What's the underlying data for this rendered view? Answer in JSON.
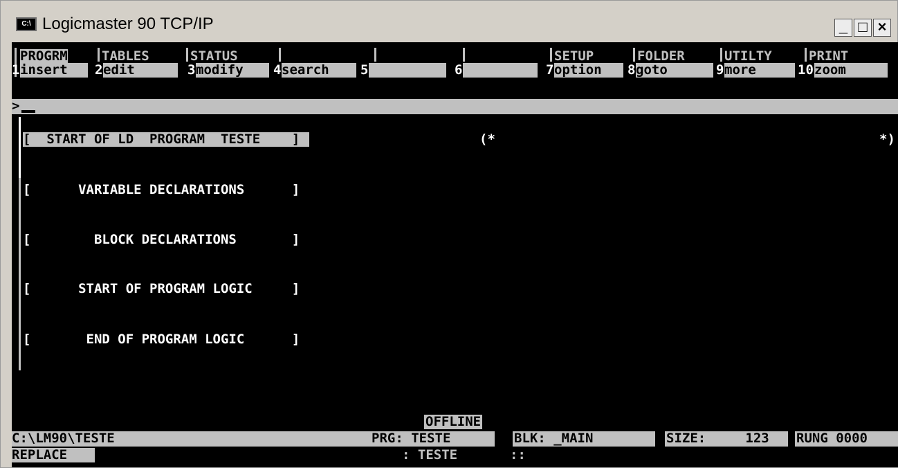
{
  "window": {
    "title": "Logicmaster 90 TCP/IP",
    "icon_label": "C:\\",
    "minimize": "_",
    "maximize": "□",
    "close": "×"
  },
  "menu": {
    "groups": [
      "PROGRM",
      "TABLES",
      "STATUS",
      "",
      "",
      "",
      "SETUP",
      "FOLDER",
      "UTILTY",
      "PRINT"
    ],
    "keys": [
      {
        "num": "1",
        "label": "insert"
      },
      {
        "num": "2",
        "label": "edit"
      },
      {
        "num": "3",
        "label": "modify"
      },
      {
        "num": "4",
        "label": "search"
      },
      {
        "num": "5",
        "label": ""
      },
      {
        "num": "6",
        "label": ""
      },
      {
        "num": "7",
        "label": "option"
      },
      {
        "num": "8",
        "label": "goto"
      },
      {
        "num": "9",
        "label": "more"
      },
      {
        "num": "10",
        "label": "zoom"
      }
    ]
  },
  "command": {
    "prompt": ">"
  },
  "program": {
    "start_line": "[  START OF LD  PROGRAM  TESTE    ]",
    "comment_open": "(*",
    "comment_close": "*)",
    "sections": [
      "[      VARIABLE DECLARATIONS      ]",
      "[        BLOCK DECLARATIONS       ]",
      "[      START OF PROGRAM LOGIC     ]",
      "[       END OF PROGRAM LOGIC      ]"
    ]
  },
  "status": {
    "mode": "OFFLINE",
    "path": "C:\\LM90\\TESTE",
    "prg": "PRG: TESTE",
    "blk": "BLK: _MAIN",
    "size": "SIZE:     123",
    "rung": "RUNG 0000",
    "edit_mode": "REPLACE",
    "prg2": ": TESTE",
    "extra": "::"
  }
}
